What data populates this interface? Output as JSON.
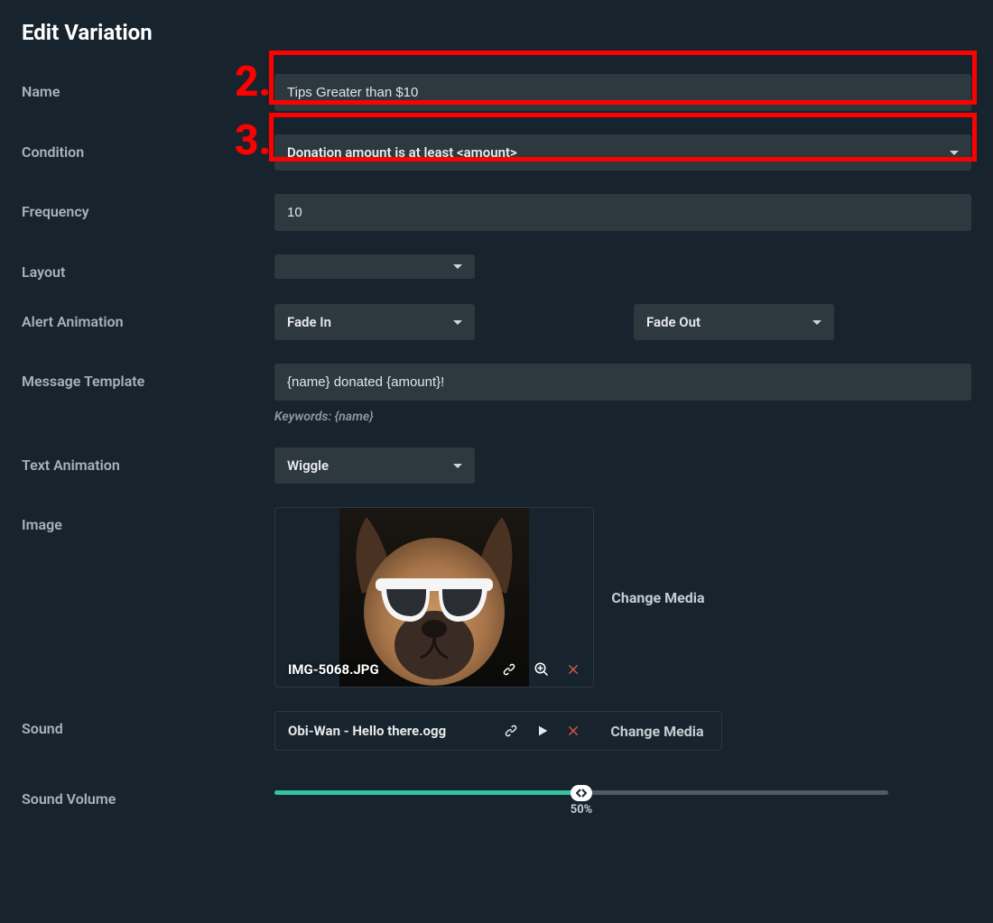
{
  "title": "Edit Variation",
  "annotations": {
    "step2": "2.",
    "step3": "3."
  },
  "labels": {
    "name": "Name",
    "condition": "Condition",
    "frequency": "Frequency",
    "layout": "Layout",
    "alert_animation": "Alert Animation",
    "message_template": "Message Template",
    "text_animation": "Text Animation",
    "image": "Image",
    "sound": "Sound",
    "sound_volume": "Sound Volume"
  },
  "name": {
    "value": "Tips Greater than $10"
  },
  "condition": {
    "value": "Donation amount is at least <amount>"
  },
  "frequency": {
    "value": "10"
  },
  "layout": {
    "value": ""
  },
  "alert_animation": {
    "in": "Fade In",
    "out": "Fade Out"
  },
  "message_template": {
    "value": "{name} donated {amount}!",
    "keywords": "Keywords: {name}"
  },
  "text_animation": {
    "value": "Wiggle"
  },
  "image": {
    "filename": "IMG-5068.JPG",
    "change": "Change Media"
  },
  "sound": {
    "filename": "Obi-Wan - Hello there.ogg",
    "change": "Change Media"
  },
  "volume": {
    "percent": 50,
    "label": "50%"
  }
}
